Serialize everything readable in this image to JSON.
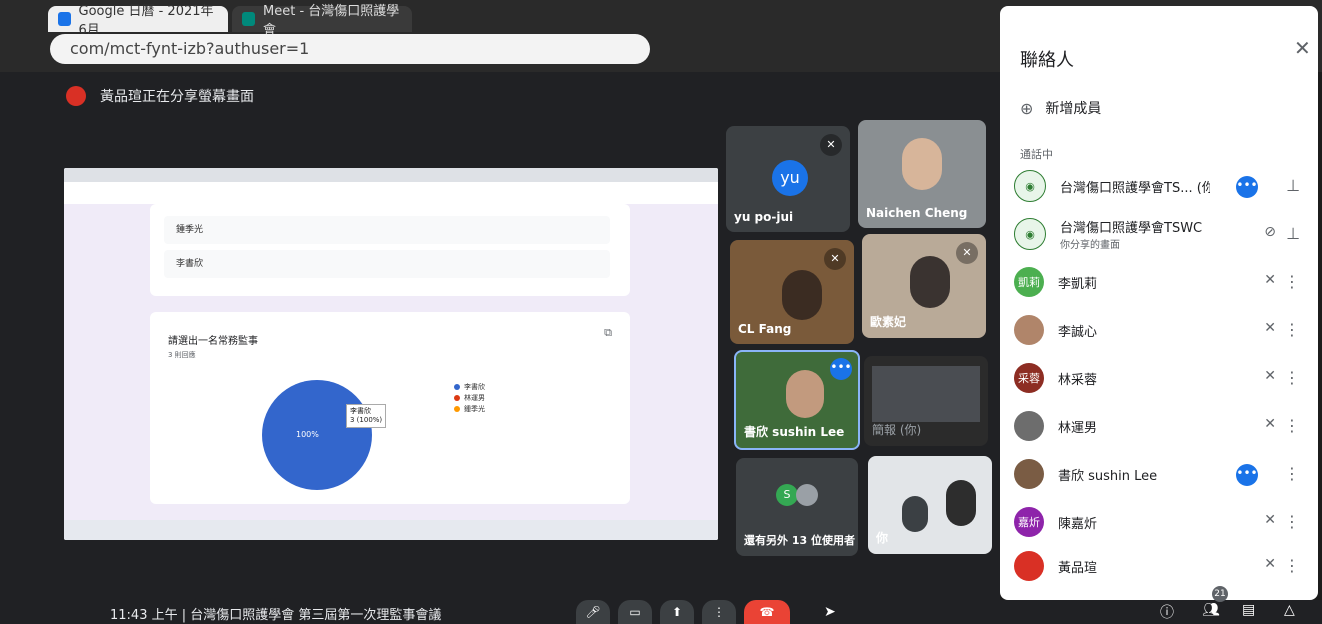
{
  "browser": {
    "tab1_title": "Google 日曆 - 2021年6月",
    "tab2_title": "Meet - 台灣傷口照護學會",
    "url": "com/mct-fynt-izb?authuser=1"
  },
  "meet": {
    "presenting_text": "黃品瑄正在分享螢幕畫面",
    "meeting_title": "11:43 上午 | 台灣傷口照護學會 第三屆第一次理監事會議",
    "participant_count": "21"
  },
  "shared_screen": {
    "options": [
      "鍾季光",
      "李書欣"
    ],
    "question": "請選出一名常務監事",
    "responses": "3 則回應",
    "tooltip_name": "李書欣",
    "tooltip_value": "3 (100%)",
    "slice_label": "100%",
    "legend": [
      "李書欣",
      "林運男",
      "鍾季光"
    ]
  },
  "chart_data": {
    "type": "pie",
    "title": "請選出一名常務監事",
    "categories": [
      "李書欣",
      "林運男",
      "鍾季光"
    ],
    "values": [
      3,
      0,
      0
    ],
    "colors": [
      "#3366cc",
      "#dc3912",
      "#ff9900"
    ]
  },
  "tiles": {
    "yu_initials": "yu",
    "yu_name": "yu po-jui",
    "naichen": "Naichen Cheng",
    "clfang": "CL Fang",
    "ou": "歐素妃",
    "sushin": "書欣 sushin Lee",
    "self": "簡報 (你)",
    "others": "還有另外 13 位使用者",
    "others_initial": "S",
    "you": "你"
  },
  "panel": {
    "title": "聯絡人",
    "add_label": "新增成員",
    "section": "通話中",
    "people": [
      {
        "name": "台灣傷口照護學會TS...",
        "suffix": "(你)",
        "sub": "",
        "avatar": "",
        "color": "#2e7d32"
      },
      {
        "name": "台灣傷口照護學會TSWC",
        "suffix": "",
        "sub": "你分享的畫面",
        "avatar": "",
        "color": "#2e7d32"
      },
      {
        "name": "李凱莉",
        "suffix": "",
        "sub": "",
        "avatar": "凱莉",
        "color": "#4caf50"
      },
      {
        "name": "李誠心",
        "suffix": "",
        "sub": "",
        "avatar": "",
        "color": "#b0856a"
      },
      {
        "name": "林采蓉",
        "suffix": "",
        "sub": "",
        "avatar": "采蓉",
        "color": "#8d2d23"
      },
      {
        "name": "林運男",
        "suffix": "",
        "sub": "",
        "avatar": "",
        "color": "#6d6d6d"
      },
      {
        "name": "書欣 sushin Lee",
        "suffix": "",
        "sub": "",
        "avatar": "",
        "color": "#7a5c44"
      },
      {
        "name": "陳嘉炘",
        "suffix": "",
        "sub": "",
        "avatar": "嘉炘",
        "color": "#8e24aa"
      },
      {
        "name": "黃品瑄",
        "suffix": "",
        "sub": "",
        "avatar": "",
        "color": "#d93025"
      }
    ]
  },
  "colors": {
    "leave": "#ea4335",
    "accent": "#1a73e8"
  }
}
